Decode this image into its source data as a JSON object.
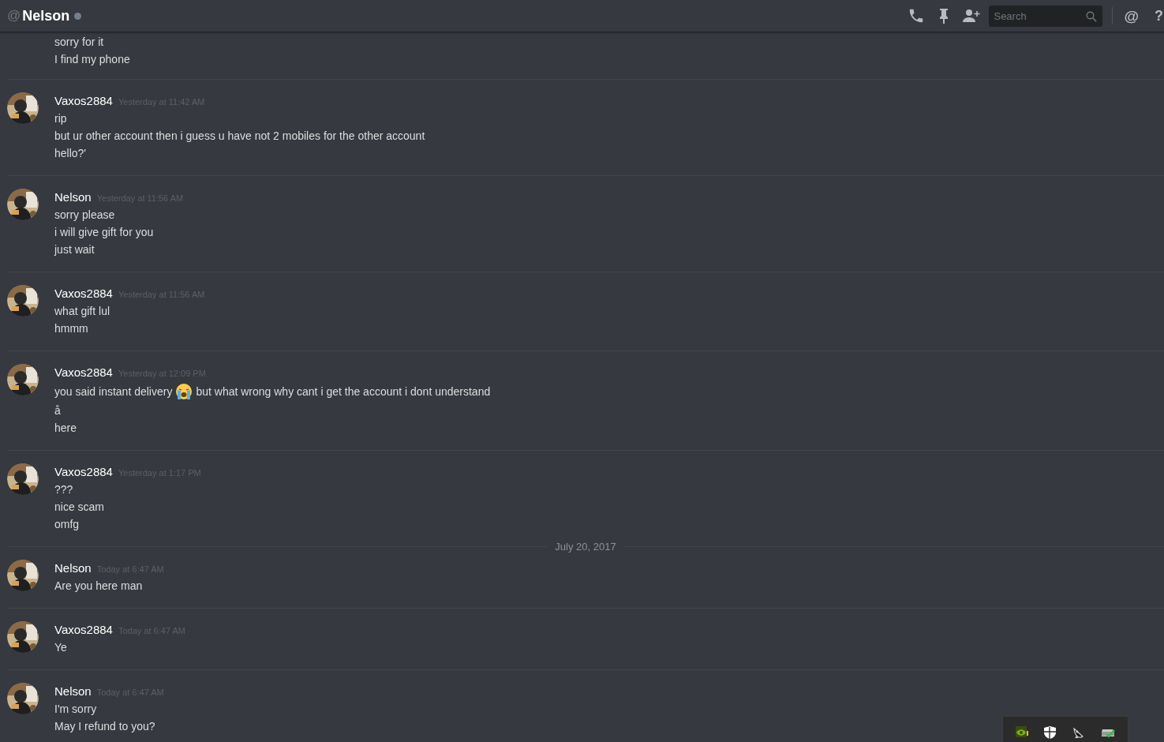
{
  "header": {
    "prefix": "@",
    "title": "Nelson",
    "online": false,
    "search": {
      "placeholder": "Search"
    },
    "mention": "@",
    "help": "?"
  },
  "messages": [
    {
      "lines": [
        "sorry for it",
        "I find my phone"
      ]
    },
    {
      "author": "Vaxos2884",
      "timestamp": "Yesterday at 11:42 AM",
      "lines": [
        "rip",
        "but ur other account then i guess u have not 2 mobiles for the other account",
        "hello?'"
      ]
    },
    {
      "author": "Nelson",
      "timestamp": "Yesterday at 11:56 AM",
      "lines": [
        "sorry please",
        "i will give gift for you",
        "just wait"
      ]
    },
    {
      "author": "Vaxos2884",
      "timestamp": "Yesterday at 11:56 AM",
      "lines": [
        "what gift lul",
        "hmmm"
      ]
    },
    {
      "author": "Vaxos2884",
      "timestamp": "Yesterday at 12:09 PM",
      "lines": [
        [
          {
            "kind": "text",
            "text": "you said instant delivery"
          },
          {
            "kind": "emoji"
          },
          {
            "kind": "text",
            "text": "but what wrong why cant i get the account i dont understand"
          }
        ],
        "å",
        "here"
      ]
    },
    {
      "author": "Vaxos2884",
      "timestamp": "Yesterday at 1:17 PM",
      "lines": [
        "???",
        "nice scam",
        "omfg"
      ]
    },
    {
      "date_divider": "July 20, 2017",
      "author": "Nelson",
      "timestamp": "Today at 6:47 AM",
      "lines": [
        "Are you here man"
      ]
    },
    {
      "author": "Vaxos2884",
      "timestamp": "Today at 6:47 AM",
      "lines": [
        "Ye"
      ]
    },
    {
      "author": "Nelson",
      "timestamp": "Today at 6:47 AM",
      "lines": [
        "I'm sorry",
        "May I refund to you?"
      ]
    }
  ],
  "tray": {
    "icons": [
      {
        "kind": "gpu"
      },
      {
        "kind": "shield"
      },
      {
        "kind": "dish"
      },
      {
        "kind": "drive"
      }
    ]
  }
}
